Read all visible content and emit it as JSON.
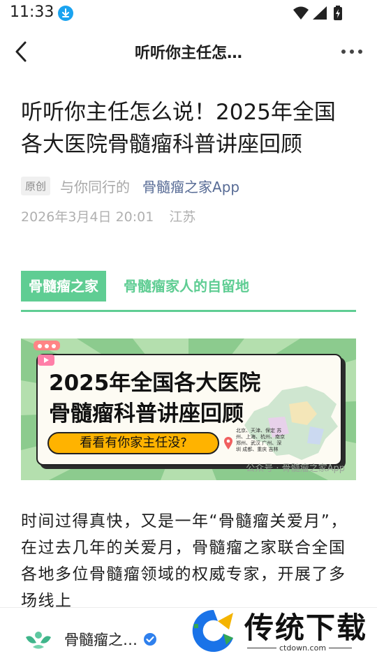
{
  "status_bar": {
    "time": "11:33",
    "icons": [
      "download-icon",
      "wifi-icon",
      "signal-icon",
      "battery-charging-icon"
    ]
  },
  "nav": {
    "title": "听听你主任怎…",
    "back_icon": "chevron-left-icon",
    "more_icon": "more-dots-icon"
  },
  "article": {
    "title": "听听你主任怎么说！2025年全国各大医院骨髓瘤科普讲座回顾",
    "original_tag": "原创",
    "author": "与你同行的",
    "account": "骨髓瘤之家App",
    "date": "2026年3月4日 20:01",
    "location": "江苏"
  },
  "section_header": {
    "tag": "骨髓瘤之家",
    "subtitle": "骨髓瘤家人的自留地"
  },
  "banner": {
    "line1": "2025年全国各大医院",
    "line2": "骨髓瘤科普讲座回顾",
    "pill": "看看有你家主任没?",
    "cities": "北京、天津、保定 苏州、上海、杭州、南京 郑州、武汉 广州、深圳 成都、重庆 吉林",
    "watermark": "公众号 · 骨髓瘤之家App"
  },
  "body": {
    "paragraph": "时间过得真快，又是一年“骨髓瘤关爱月”，在过去几年的关爱月，骨髓瘤之家联合全国各地多位骨髓瘤领域的权威专家，开展了多场线上"
  },
  "bottom_bar": {
    "account_name": "骨髓瘤之…",
    "verified_icon": "verified-badge-icon",
    "logo_icon": "account-logo-icon"
  },
  "site_watermark": {
    "name": "传统下载",
    "domain": "ctdown.com"
  },
  "colors": {
    "accent_green": "#5fcd93",
    "link_blue": "#576b95",
    "pill_yellow": "#ffb300",
    "download_blue": "#1aa3f0"
  }
}
